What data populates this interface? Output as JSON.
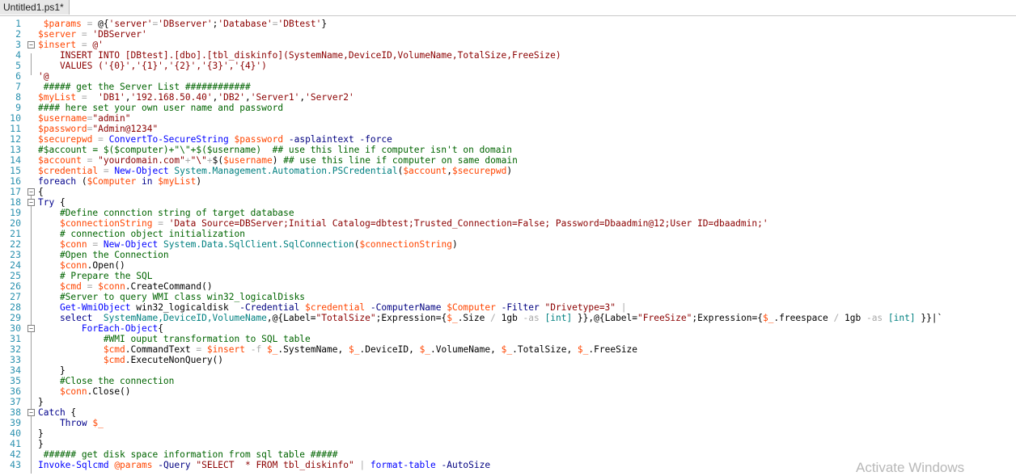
{
  "tab": {
    "title": "Untitled1.ps1*"
  },
  "watermark": "Activate Windows",
  "lines": [
    {
      "n": "1",
      "fold": "",
      "tokens": [
        [
          "txt",
          " "
        ],
        [
          "var",
          "$params"
        ],
        [
          "op",
          " = "
        ],
        [
          "txt",
          "@{"
        ],
        [
          "str",
          "'server'"
        ],
        [
          "op",
          "="
        ],
        [
          "str",
          "'DBserver'"
        ],
        [
          "txt",
          ";"
        ],
        [
          "str",
          "'Database'"
        ],
        [
          "op",
          "="
        ],
        [
          "str",
          "'DBtest'"
        ],
        [
          "txt",
          "}"
        ]
      ]
    },
    {
      "n": "2",
      "fold": "",
      "tokens": [
        [
          "var",
          "$server"
        ],
        [
          "op",
          " = "
        ],
        [
          "str",
          "'DBServer'"
        ]
      ]
    },
    {
      "n": "3",
      "fold": "−",
      "tokens": [
        [
          "var",
          "$insert"
        ],
        [
          "op",
          " = "
        ],
        [
          "str",
          "@'"
        ]
      ]
    },
    {
      "n": "4",
      "fold": "",
      "tokens": [
        [
          "str",
          "    INSERT INTO [DBtest].[dbo].[tbl_diskinfo](SystemName,DeviceID,VolumeName,TotalSize,FreeSize)"
        ]
      ]
    },
    {
      "n": "5",
      "fold": "",
      "tokens": [
        [
          "str",
          "    VALUES ('{0}','{1}','{2}','{3}','{4}')"
        ]
      ]
    },
    {
      "n": "6",
      "fold": "",
      "tokens": [
        [
          "str",
          "'@"
        ]
      ]
    },
    {
      "n": "7",
      "fold": "",
      "tokens": [
        [
          "cmt",
          " ##### get the Server List ############"
        ]
      ]
    },
    {
      "n": "8",
      "fold": "",
      "tokens": [
        [
          "var",
          "$myList"
        ],
        [
          "op",
          " = "
        ],
        [
          "str",
          " 'DB1'"
        ],
        [
          "txt",
          ","
        ],
        [
          "str",
          "'192.168.50.40'"
        ],
        [
          "txt",
          ","
        ],
        [
          "str",
          "'DB2'"
        ],
        [
          "txt",
          ","
        ],
        [
          "str",
          "'Server1'"
        ],
        [
          "txt",
          ","
        ],
        [
          "str",
          "'Server2'"
        ]
      ]
    },
    {
      "n": "9",
      "fold": "",
      "tokens": [
        [
          "cmt",
          "#### here set your own user name and password"
        ]
      ]
    },
    {
      "n": "10",
      "fold": "",
      "tokens": [
        [
          "var",
          "$username"
        ],
        [
          "op",
          "="
        ],
        [
          "str",
          "\"admin\""
        ]
      ]
    },
    {
      "n": "11",
      "fold": "",
      "tokens": [
        [
          "var",
          "$password"
        ],
        [
          "op",
          "="
        ],
        [
          "str",
          "\"Admin@1234\""
        ]
      ]
    },
    {
      "n": "12",
      "fold": "",
      "tokens": [
        [
          "var",
          "$securepwd"
        ],
        [
          "op",
          " = "
        ],
        [
          "cmd",
          "ConvertTo-SecureString"
        ],
        [
          "txt",
          " "
        ],
        [
          "var",
          "$password"
        ],
        [
          "prm",
          " -asplaintext"
        ],
        [
          "prm",
          " -force"
        ]
      ]
    },
    {
      "n": "13",
      "fold": "",
      "tokens": [
        [
          "cmt",
          "#$account = $($computer)+\"\\\"+$($username)  ## use this line if computer isn't on domain"
        ]
      ]
    },
    {
      "n": "14",
      "fold": "",
      "tokens": [
        [
          "var",
          "$account"
        ],
        [
          "op",
          " = "
        ],
        [
          "str",
          "\"yourdomain.com\""
        ],
        [
          "op",
          "+"
        ],
        [
          "str",
          "\"\\\""
        ],
        [
          "op",
          "+"
        ],
        [
          "txt",
          "$("
        ],
        [
          "var",
          "$username"
        ],
        [
          "txt",
          ")"
        ],
        [
          "cmt",
          " ## use this line if computer on same domain"
        ]
      ]
    },
    {
      "n": "15",
      "fold": "",
      "tokens": [
        [
          "var",
          "$credential"
        ],
        [
          "op",
          " = "
        ],
        [
          "cmd",
          "New-Object"
        ],
        [
          "typ",
          " System.Management.Automation.PSCredential"
        ],
        [
          "txt",
          "("
        ],
        [
          "var",
          "$account"
        ],
        [
          "txt",
          ","
        ],
        [
          "var",
          "$securepwd"
        ],
        [
          "txt",
          ")"
        ]
      ]
    },
    {
      "n": "16",
      "fold": "",
      "tokens": [
        [
          "kw",
          "foreach"
        ],
        [
          "txt",
          " ("
        ],
        [
          "var",
          "$Computer"
        ],
        [
          "kw",
          " in "
        ],
        [
          "var",
          "$myList"
        ],
        [
          "txt",
          ")"
        ]
      ]
    },
    {
      "n": "17",
      "fold": "−",
      "tokens": [
        [
          "txt",
          "{"
        ]
      ]
    },
    {
      "n": "18",
      "fold": "−",
      "tokens": [
        [
          "kw",
          "Try"
        ],
        [
          "txt",
          " {"
        ]
      ]
    },
    {
      "n": "19",
      "fold": "",
      "tokens": [
        [
          "cmt",
          "    #Define connction string of target database"
        ]
      ]
    },
    {
      "n": "20",
      "fold": "",
      "tokens": [
        [
          "txt",
          "    "
        ],
        [
          "var",
          "$connectionString"
        ],
        [
          "op",
          " = "
        ],
        [
          "str",
          "'Data Source=DBServer;Initial Catalog=dbtest;Trusted_Connection=False; Password=Dbaadmin@12;User ID=dbaadmin;'"
        ]
      ]
    },
    {
      "n": "21",
      "fold": "",
      "tokens": [
        [
          "cmt",
          "    # connection object initialization"
        ]
      ]
    },
    {
      "n": "22",
      "fold": "",
      "tokens": [
        [
          "txt",
          "    "
        ],
        [
          "var",
          "$conn"
        ],
        [
          "op",
          " = "
        ],
        [
          "cmd",
          "New-Object"
        ],
        [
          "typ",
          " System.Data.SqlClient.SqlConnection"
        ],
        [
          "txt",
          "("
        ],
        [
          "var",
          "$connectionString"
        ],
        [
          "txt",
          ")"
        ]
      ]
    },
    {
      "n": "23",
      "fold": "",
      "tokens": [
        [
          "cmt",
          "    #Open the Connection"
        ]
      ]
    },
    {
      "n": "24",
      "fold": "",
      "tokens": [
        [
          "txt",
          "    "
        ],
        [
          "var",
          "$conn"
        ],
        [
          "txt",
          ".Open()"
        ]
      ]
    },
    {
      "n": "25",
      "fold": "",
      "tokens": [
        [
          "cmt",
          "    # Prepare the SQL"
        ]
      ]
    },
    {
      "n": "26",
      "fold": "",
      "tokens": [
        [
          "txt",
          "    "
        ],
        [
          "var",
          "$cmd"
        ],
        [
          "op",
          " = "
        ],
        [
          "var",
          "$conn"
        ],
        [
          "txt",
          ".CreateCommand()"
        ]
      ]
    },
    {
      "n": "27",
      "fold": "",
      "tokens": [
        [
          "cmt",
          "    #Server to query WMI class win32_logicalDisks"
        ]
      ]
    },
    {
      "n": "28",
      "fold": "",
      "tokens": [
        [
          "txt",
          "    "
        ],
        [
          "cmd",
          "Get-WmiObject"
        ],
        [
          "txt",
          " win32_logicaldisk "
        ],
        [
          "prm",
          " -Credential"
        ],
        [
          "txt",
          " "
        ],
        [
          "var",
          "$credential"
        ],
        [
          "prm",
          " -ComputerName"
        ],
        [
          "txt",
          " "
        ],
        [
          "var",
          "$Computer"
        ],
        [
          "prm",
          " -Filter"
        ],
        [
          "str",
          " \"Drivetype=3\""
        ],
        [
          "op",
          " |"
        ]
      ]
    },
    {
      "n": "29",
      "fold": "",
      "tokens": [
        [
          "txt",
          "    "
        ],
        [
          "kw",
          "select"
        ],
        [
          "typ",
          "  SystemName,DeviceID,VolumeName"
        ],
        [
          "txt",
          ",@{Label="
        ],
        [
          "str",
          "\"TotalSize\""
        ],
        [
          "txt",
          ";Expression={"
        ],
        [
          "var",
          "$_"
        ],
        [
          "txt",
          ".Size "
        ],
        [
          "op",
          "/"
        ],
        [
          "txt",
          " 1gb "
        ],
        [
          "op",
          "-as"
        ],
        [
          "typ",
          " [int]"
        ],
        [
          "txt",
          " }},@{Label="
        ],
        [
          "str",
          "\"FreeSize\""
        ],
        [
          "txt",
          ";Expression={"
        ],
        [
          "var",
          "$_"
        ],
        [
          "txt",
          ".freespace "
        ],
        [
          "op",
          "/"
        ],
        [
          "txt",
          " 1gb "
        ],
        [
          "op",
          "-as"
        ],
        [
          "typ",
          " [int]"
        ],
        [
          "txt",
          " }}|`"
        ]
      ]
    },
    {
      "n": "30",
      "fold": "−",
      "tokens": [
        [
          "cmd",
          "        ForEach-Object"
        ],
        [
          "txt",
          "{"
        ]
      ]
    },
    {
      "n": "31",
      "fold": "",
      "tokens": [
        [
          "cmt",
          "            #WMI ouput transformation to SQL table"
        ]
      ]
    },
    {
      "n": "32",
      "fold": "",
      "tokens": [
        [
          "txt",
          "            "
        ],
        [
          "var",
          "$cmd"
        ],
        [
          "txt",
          ".CommandText"
        ],
        [
          "op",
          " = "
        ],
        [
          "var",
          "$insert"
        ],
        [
          "op",
          " -f "
        ],
        [
          "var",
          "$_"
        ],
        [
          "txt",
          ".SystemName, "
        ],
        [
          "var",
          "$_"
        ],
        [
          "txt",
          ".DeviceID, "
        ],
        [
          "var",
          "$_"
        ],
        [
          "txt",
          ".VolumeName, "
        ],
        [
          "var",
          "$_"
        ],
        [
          "txt",
          ".TotalSize, "
        ],
        [
          "var",
          "$_"
        ],
        [
          "txt",
          ".FreeSize"
        ]
      ]
    },
    {
      "n": "33",
      "fold": "",
      "tokens": [
        [
          "txt",
          "            "
        ],
        [
          "var",
          "$cmd"
        ],
        [
          "txt",
          ".ExecuteNonQuery()"
        ]
      ]
    },
    {
      "n": "34",
      "fold": "",
      "tokens": [
        [
          "txt",
          "    }"
        ]
      ]
    },
    {
      "n": "35",
      "fold": "",
      "tokens": [
        [
          "cmt",
          "    #Close the connection"
        ]
      ]
    },
    {
      "n": "36",
      "fold": "",
      "tokens": [
        [
          "txt",
          "    "
        ],
        [
          "var",
          "$conn"
        ],
        [
          "txt",
          ".Close()"
        ]
      ]
    },
    {
      "n": "37",
      "fold": "",
      "tokens": [
        [
          "txt",
          "}"
        ]
      ]
    },
    {
      "n": "38",
      "fold": "−",
      "tokens": [
        [
          "kw",
          "Catch"
        ],
        [
          "txt",
          " {"
        ]
      ]
    },
    {
      "n": "39",
      "fold": "",
      "tokens": [
        [
          "kw",
          "    Throw"
        ],
        [
          "txt",
          " "
        ],
        [
          "var",
          "$_"
        ]
      ]
    },
    {
      "n": "40",
      "fold": "",
      "tokens": [
        [
          "txt",
          "}"
        ]
      ]
    },
    {
      "n": "41",
      "fold": "",
      "tokens": [
        [
          "txt",
          "}"
        ]
      ]
    },
    {
      "n": "42",
      "fold": "",
      "tokens": [
        [
          "cmt",
          " ###### get disk space information from sql table #####"
        ]
      ]
    },
    {
      "n": "43",
      "fold": "",
      "tokens": [
        [
          "cmd",
          "Invoke-Sqlcmd"
        ],
        [
          "txt",
          " "
        ],
        [
          "var",
          "@params"
        ],
        [
          "prm",
          " -Query"
        ],
        [
          "str",
          " \"SELECT  * FROM tbl_diskinfo\""
        ],
        [
          "op",
          " | "
        ],
        [
          "cmd",
          "format-table"
        ],
        [
          "prm",
          " -AutoSize"
        ]
      ]
    }
  ]
}
